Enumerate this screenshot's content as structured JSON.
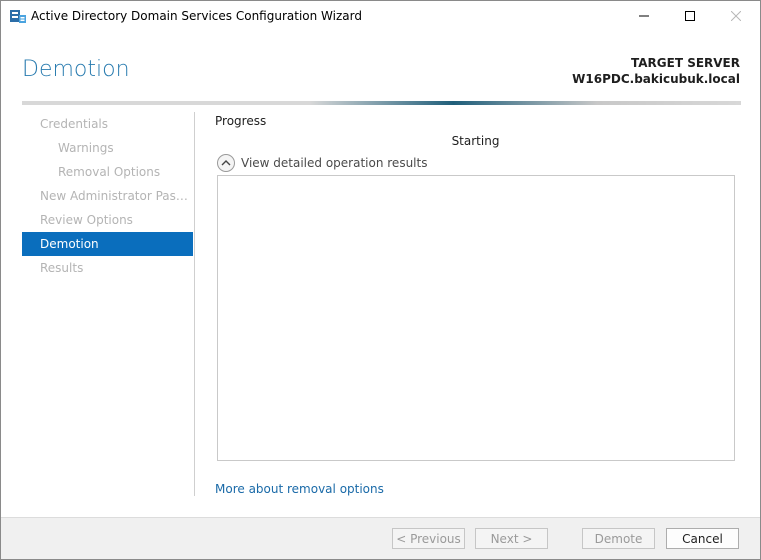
{
  "window": {
    "title": "Active Directory Domain Services Configuration Wizard",
    "minimize_glyph": "─",
    "maximize_glyph": "☐",
    "close_glyph": "✕"
  },
  "header": {
    "page_title": "Demotion",
    "target_label": "TARGET SERVER",
    "target_name": "W16PDC.bakicubuk.local"
  },
  "nav": {
    "items": [
      {
        "label": "Credentials",
        "level": 0,
        "state": "inactive"
      },
      {
        "label": "Warnings",
        "level": 1,
        "state": "inactive"
      },
      {
        "label": "Removal Options",
        "level": 1,
        "state": "inactive"
      },
      {
        "label": "New Administrator Passw...",
        "level": 0,
        "state": "inactive"
      },
      {
        "label": "Review Options",
        "level": 0,
        "state": "inactive"
      },
      {
        "label": "Demotion",
        "level": 0,
        "state": "active"
      },
      {
        "label": "Results",
        "level": 0,
        "state": "inactive"
      }
    ]
  },
  "main": {
    "section_label": "Progress",
    "status": "Starting",
    "expander_label": "View detailed operation results",
    "expander_icon": "chevron-up-icon",
    "more_link": "More about removal options"
  },
  "footer": {
    "previous": "< Previous",
    "next": "Next >",
    "demote": "Demote",
    "cancel": "Cancel"
  },
  "colors": {
    "accent": "#0a6ebd",
    "title_blue": "#2a7cb0",
    "link": "#1a6aa8",
    "disabled_text": "#b4b4b4"
  }
}
